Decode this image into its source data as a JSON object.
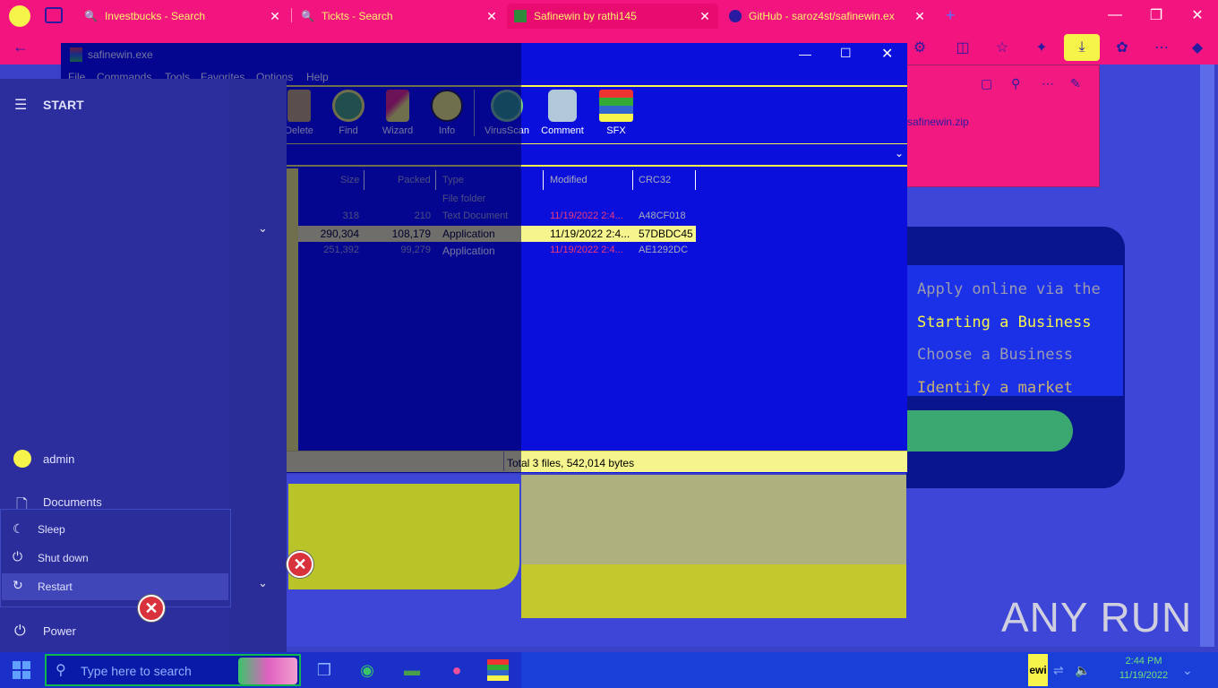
{
  "browser": {
    "tabs": [
      {
        "title": "Investbucks - Search"
      },
      {
        "title": "Tickts - Search"
      },
      {
        "title": "Safinewin by rathi145"
      },
      {
        "title": "GitHub - saroz4st/safinewin.ex"
      }
    ],
    "download_panel_text": "safinewin.zip"
  },
  "page": {
    "code_lines": [
      "Apply online via the",
      "Starting a Business",
      "Choose a Business",
      "Identify a market"
    ],
    "watermark": "ANY RUN"
  },
  "rar": {
    "title": "safinewin.exe",
    "menu": [
      "File",
      "Commands",
      "Tools",
      "Favorites",
      "Options",
      "Help"
    ],
    "tools": [
      "Delete",
      "Find",
      "Wizard",
      "Info",
      "VirusScan",
      "Comment",
      "SFX"
    ],
    "columns": [
      "Size",
      "Packed",
      "Type",
      "Modified",
      "CRC32"
    ],
    "rows": [
      {
        "size": "",
        "packed": "",
        "type": "File folder",
        "modified": "",
        "crc": ""
      },
      {
        "size": "318",
        "packed": "210",
        "type": "Text Document",
        "modified": "11/19/2022 2:4...",
        "crc": "A48CF018"
      },
      {
        "size": "290,304",
        "packed": "108,179",
        "type": "Application",
        "modified": "11/19/2022 2:4...",
        "crc": "57DBDC45"
      },
      {
        "size": "251,392",
        "packed": "99,279",
        "type": "Application",
        "modified": "11/19/2022 2:4...",
        "crc": "AE1292DC"
      }
    ],
    "status": "Total 3 files, 542,014 bytes"
  },
  "start": {
    "header": "START",
    "user": "admin",
    "documents": "Documents",
    "power_items": [
      "Sleep",
      "Shut down",
      "Restart"
    ],
    "power": "Power"
  },
  "taskbar": {
    "search_placeholder": "Type here to search",
    "tray_label": "ewi",
    "time": "2:44 PM",
    "date": "11/19/2022"
  },
  "colors": {
    "accent_pink": "#f2157f",
    "rar_blue": "#0a0fdc",
    "highlight_yellow": "#f6f48c"
  }
}
